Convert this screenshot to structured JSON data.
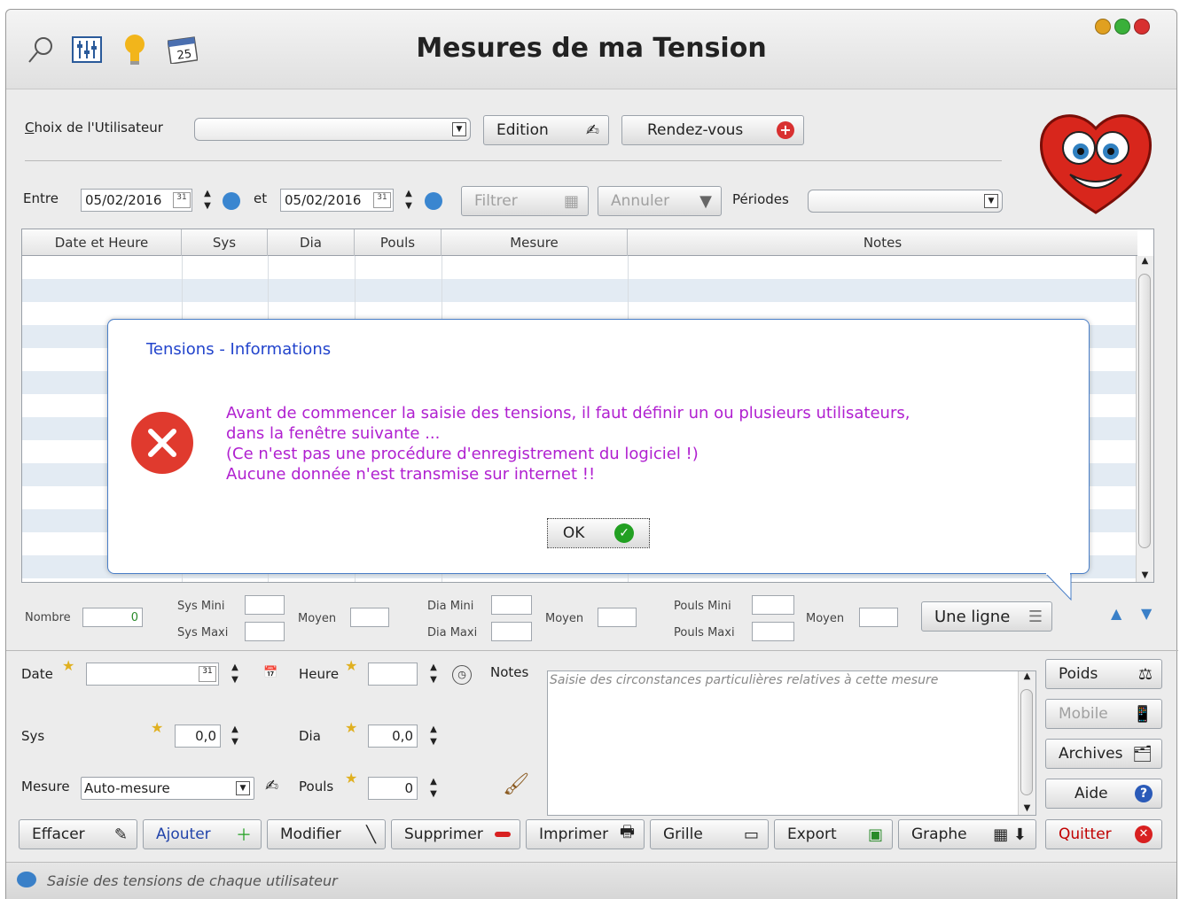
{
  "window": {
    "title": "Mesures de ma Tension",
    "toolbar_icons": [
      "search-icon",
      "sliders-icon",
      "lightbulb-icon",
      "calendar-icon"
    ],
    "calendar_day": "25"
  },
  "user_row": {
    "label_prefix": "C",
    "label_rest": "hoix de l'Utilisateur",
    "edition_label": "Edition",
    "rdv_label": "Rendez-vous"
  },
  "filter_row": {
    "entre_label": "Entre",
    "date_from": "05/02/2016",
    "et_label": "et",
    "date_to": "05/02/2016",
    "cal_day": "31",
    "filtrer_label": "Filtrer",
    "annuler_label": "Annuler",
    "periodes_label": "Périodes"
  },
  "grid": {
    "columns": [
      "Date et Heure",
      "Sys",
      "Dia",
      "Pouls",
      "Mesure",
      "Notes"
    ]
  },
  "dialog": {
    "title": "Tensions - Informations",
    "lines": [
      "Avant de commencer la saisie des tensions, il faut définir un ou plusieurs utilisateurs,",
      "dans la fenêtre suivante ...",
      "(Ce n'est pas une procédure d'enregistrement du logiciel !)",
      "Aucune donnée n'est transmise sur internet !!"
    ],
    "ok_label": "OK"
  },
  "stats": {
    "nombre_label": "Nombre",
    "nombre_value": "0",
    "sys_mini": "Sys Mini",
    "sys_maxi": "Sys Maxi",
    "moyen": "Moyen",
    "dia_mini": "Dia Mini",
    "dia_maxi": "Dia Maxi",
    "pouls_mini": "Pouls Mini",
    "pouls_maxi": "Pouls Maxi",
    "une_ligne_label": "Une ligne"
  },
  "form": {
    "date_label": "Date",
    "heure_label": "Heure",
    "notes_label": "Notes",
    "notes_placeholder": "Saisie des circonstances particulières relatives à cette mesure",
    "sys_label": "Sys",
    "sys_value": "0,0",
    "dia_label": "Dia",
    "dia_value": "0,0",
    "mesure_label": "Mesure",
    "mesure_value": "Auto-mesure",
    "pouls_label": "Pouls",
    "pouls_value": "0",
    "poids_label": "Poids",
    "mobile_label": "Mobile",
    "archives_label": "Archives",
    "aide_label": "Aide"
  },
  "bottom_buttons": {
    "effacer": "Effacer",
    "ajouter": "Ajouter",
    "modifier": "Modifier",
    "supprimer": "Supprimer",
    "imprimer": "Imprimer",
    "grille": "Grille",
    "export": "Export",
    "graphe": "Graphe",
    "quitter": "Quitter"
  },
  "status": {
    "text": "Saisie des tensions de chaque utilisateur"
  },
  "colors": {
    "dialog_title": "#2244cc",
    "dialog_text": "#b020d0",
    "error_red": "#e03a2e",
    "ok_green": "#22a022",
    "quitter_red": "#c00000",
    "row_stripe": "#e3ebf3"
  }
}
